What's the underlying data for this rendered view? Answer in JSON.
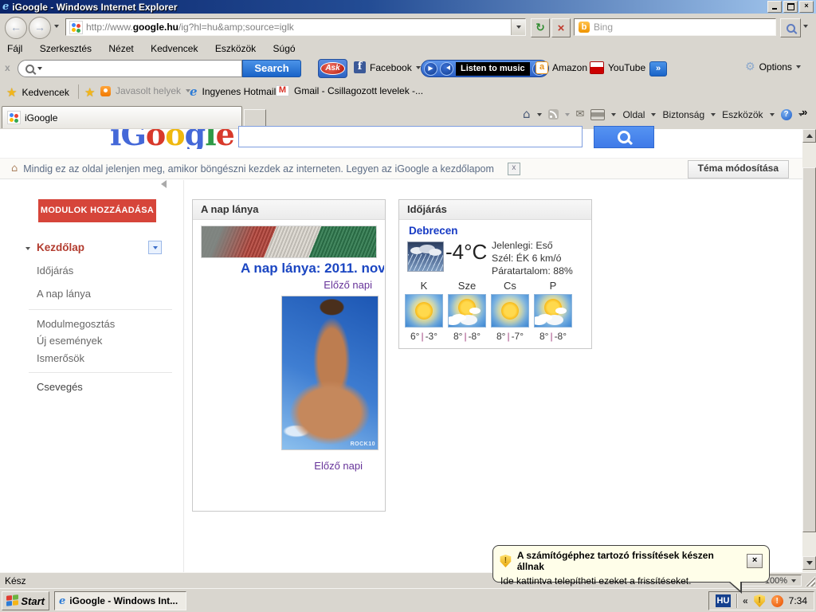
{
  "icons": {
    "close": "×",
    "back": "←",
    "forward": "→",
    "refresh": "↻",
    "stop": "×",
    "chevron_right": "»",
    "chevron_left": "«",
    "home": "⌂",
    "mail": "✉",
    "gear": "⚙",
    "star": "★",
    "help": "?",
    "play": "▶",
    "x_small": "x",
    "excl": "!",
    "ie_letter": "e",
    "bing_letter": "b",
    "gmail_letter": "M",
    "facebook_letter": "f",
    "amazon_letter": "a"
  },
  "window": {
    "title": "iGoogle - Windows Internet Explorer"
  },
  "address": {
    "url_prefix": "http://www.",
    "url_domain": "google.hu",
    "url_path": "/ig?hl=hu&amp;source=iglk",
    "bing": "Bing"
  },
  "menu": {
    "items": [
      "Fájl",
      "Szerkesztés",
      "Nézet",
      "Kedvencek",
      "Eszközök",
      "Súgó"
    ]
  },
  "toolbar": {
    "search_label": "Search",
    "ask": "Ask",
    "facebook": "Facebook",
    "listen": "Listen to music",
    "amazon": "Amazon",
    "youtube": "YouTube",
    "options": "Options"
  },
  "favorites": {
    "label": "Kedvencek",
    "suggested": "Javasolt helyek",
    "hotmail": "Ingyenes Hotmail",
    "gmail": "Gmail - Csillagozott levelek -..."
  },
  "tab": {
    "title": "iGoogle"
  },
  "command_bar": {
    "page": "Oldal",
    "security": "Biztonság",
    "tools": "Eszközök"
  },
  "page": {
    "logo_letters": [
      "i",
      "G",
      "o",
      "o",
      "g",
      "l",
      "e"
    ],
    "notice": "Mindig ez az oldal jelenjen meg, amikor böngészni kezdek az interneten. Legyen az iGoogle a kezdőlapom",
    "theme_button": "Téma módosítása",
    "sidebar": {
      "add_modules": "MODULOK HOZZÁADÁSA",
      "home": "Kezdőlap",
      "weather": "Időjárás",
      "girl": "A nap lánya",
      "share": "Modulmegosztás",
      "events": "Új események",
      "friends": "Ismerősök",
      "chat": "Csevegés"
    },
    "girl_module": {
      "title": "A nap lánya",
      "headline": "A nap lánya: 2011. nov",
      "prev1": "Előző napi",
      "prev2": "Előző napi",
      "watermark": "ROCK10"
    },
    "weather_module": {
      "title": "Időjárás",
      "city": "Debrecen",
      "temp": "-4°C",
      "current": "Jelenlegi: Eső",
      "wind": "Szél: ÉK 6 km/ó",
      "humidity": "Páratartalom: 88%",
      "sep": "|",
      "days": [
        {
          "name": "K",
          "high": "6°",
          "low": "-3°",
          "icon": "sunny"
        },
        {
          "name": "Sze",
          "high": "8°",
          "low": "-8°",
          "icon": "partly-cloudy"
        },
        {
          "name": "Cs",
          "high": "8°",
          "low": "-7°",
          "icon": "sunny"
        },
        {
          "name": "P",
          "high": "8°",
          "low": "-8°",
          "icon": "partly-cloudy"
        }
      ]
    }
  },
  "balloon": {
    "title": "A számítógéphez tartozó frissítések készen állnak",
    "body": "Ide kattintva telepítheti ezeket a frissítéseket."
  },
  "status": {
    "text": "Kész",
    "zoom": "100%"
  },
  "taskbar": {
    "start": "Start",
    "task": "iGoogle - Windows Int...",
    "lang": "HU",
    "time": "7:34"
  }
}
